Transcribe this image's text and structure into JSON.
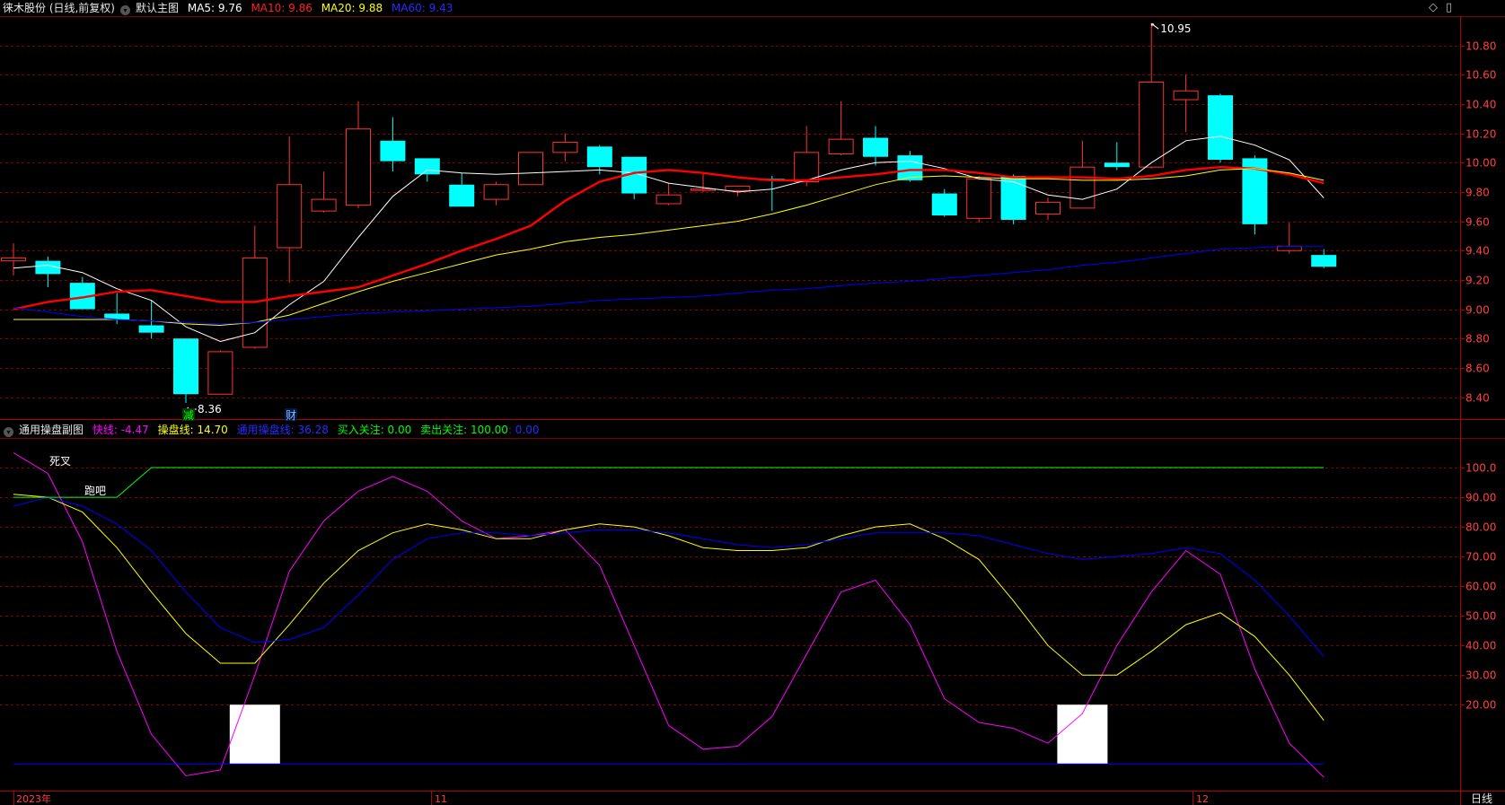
{
  "main_header": {
    "stock": "徕木股份 (日线,前复权)",
    "chart_name": "默认主图",
    "ma5": "MA5: 9.76",
    "ma10": "MA10: 9.86",
    "ma20": "MA20: 9.88",
    "ma60": "MA60: 9.43",
    "diamond_icon": "diamond-icon",
    "menu_icon": "menu-icon"
  },
  "sub_header": {
    "name": "通用操盘副图",
    "fast": "快线: -4.47",
    "op": "操盘线: 14.70",
    "general": "通用操盘线: 36.28",
    "buy": "买入关注: 0.00",
    "sell": "卖出关注: 100.00",
    "tail": ": 0.00"
  },
  "colors": {
    "bg": "#000000",
    "up": "#ff3232",
    "down": "#00ffff",
    "grid": "#800000",
    "ma5": "#ffffff",
    "ma10": "#ff0000",
    "ma20": "#ffff00",
    "ma60": "#0000ff",
    "fast": "#ff00ff",
    "op": "#ffff00",
    "general": "#0000ff",
    "sell": "#00ff00"
  },
  "annotations": {
    "high": "10.95",
    "low": "8.36",
    "jian": "减",
    "cai": "财",
    "dead_cross": "死叉",
    "run": "跑吧"
  },
  "x_labels": [
    "2023年",
    "11",
    "12"
  ],
  "period_label": "日线",
  "main_y_ticks": [
    "10.80",
    "10.60",
    "10.40",
    "10.20",
    "10.00",
    "9.80",
    "9.60",
    "9.40",
    "9.20",
    "9.00",
    "8.80",
    "8.60",
    "8.40"
  ],
  "sub_y_ticks": [
    "100.0",
    "90.00",
    "80.00",
    "70.00",
    "60.00",
    "50.00",
    "40.00",
    "30.00",
    "20.00"
  ],
  "chart_data": [
    {
      "type": "candlestick",
      "title": "默认主图",
      "ylim": [
        8.25,
        11.0
      ],
      "candles": [
        {
          "o": 9.33,
          "h": 9.45,
          "l": 9.23,
          "c": 9.35
        },
        {
          "o": 9.33,
          "h": 9.36,
          "l": 9.15,
          "c": 9.24
        },
        {
          "o": 9.18,
          "h": 9.22,
          "l": 9.0,
          "c": 9.0
        },
        {
          "o": 8.97,
          "h": 9.11,
          "l": 8.9,
          "c": 8.93
        },
        {
          "o": 8.89,
          "h": 9.06,
          "l": 8.8,
          "c": 8.84
        },
        {
          "o": 8.8,
          "h": 8.8,
          "l": 8.36,
          "c": 8.42
        },
        {
          "o": 8.42,
          "h": 8.72,
          "l": 8.42,
          "c": 8.71
        },
        {
          "o": 8.74,
          "h": 9.57,
          "l": 8.73,
          "c": 9.35
        },
        {
          "o": 9.42,
          "h": 10.18,
          "l": 9.18,
          "c": 9.85
        },
        {
          "o": 9.67,
          "h": 9.94,
          "l": 9.66,
          "c": 9.75
        },
        {
          "o": 9.71,
          "h": 10.42,
          "l": 9.69,
          "c": 10.23
        },
        {
          "o": 10.15,
          "h": 10.31,
          "l": 9.94,
          "c": 10.01
        },
        {
          "o": 10.03,
          "h": 10.03,
          "l": 9.87,
          "c": 9.92
        },
        {
          "o": 9.85,
          "h": 9.93,
          "l": 9.7,
          "c": 9.7
        },
        {
          "o": 9.75,
          "h": 9.87,
          "l": 9.71,
          "c": 9.85
        },
        {
          "o": 9.85,
          "h": 10.07,
          "l": 9.85,
          "c": 10.07
        },
        {
          "o": 10.07,
          "h": 10.2,
          "l": 10.01,
          "c": 10.14
        },
        {
          "o": 10.11,
          "h": 10.12,
          "l": 9.92,
          "c": 9.97
        },
        {
          "o": 10.04,
          "h": 10.04,
          "l": 9.75,
          "c": 9.79
        },
        {
          "o": 9.72,
          "h": 9.86,
          "l": 9.71,
          "c": 9.78
        },
        {
          "o": 9.82,
          "h": 9.93,
          "l": 9.8,
          "c": 9.82
        },
        {
          "o": 9.81,
          "h": 9.84,
          "l": 9.77,
          "c": 9.84
        },
        {
          "o": 9.89,
          "h": 9.91,
          "l": 9.67,
          "c": 9.88
        },
        {
          "o": 9.87,
          "h": 10.25,
          "l": 9.84,
          "c": 10.07
        },
        {
          "o": 10.06,
          "h": 10.42,
          "l": 10.05,
          "c": 10.16
        },
        {
          "o": 10.17,
          "h": 10.25,
          "l": 9.98,
          "c": 10.04
        },
        {
          "o": 10.05,
          "h": 10.08,
          "l": 9.87,
          "c": 9.88
        },
        {
          "o": 9.79,
          "h": 9.82,
          "l": 9.63,
          "c": 9.64
        },
        {
          "o": 9.62,
          "h": 9.91,
          "l": 9.59,
          "c": 9.89
        },
        {
          "o": 9.91,
          "h": 9.92,
          "l": 9.58,
          "c": 9.61
        },
        {
          "o": 9.65,
          "h": 9.76,
          "l": 9.61,
          "c": 9.73
        },
        {
          "o": 9.69,
          "h": 10.15,
          "l": 9.69,
          "c": 9.97
        },
        {
          "o": 10.0,
          "h": 10.14,
          "l": 9.95,
          "c": 9.97
        },
        {
          "o": 9.97,
          "h": 10.95,
          "l": 9.96,
          "c": 10.55
        },
        {
          "o": 10.43,
          "h": 10.6,
          "l": 10.21,
          "c": 10.49
        },
        {
          "o": 10.46,
          "h": 10.47,
          "l": 10.0,
          "c": 10.02
        },
        {
          "o": 10.03,
          "h": 10.05,
          "l": 9.51,
          "c": 9.58
        },
        {
          "o": 9.4,
          "h": 9.59,
          "l": 9.38,
          "c": 9.43
        },
        {
          "o": 9.37,
          "h": 9.41,
          "l": 9.28,
          "c": 9.29
        }
      ],
      "series": [
        {
          "name": "MA5",
          "values": [
            9.28,
            9.3,
            9.25,
            9.14,
            9.06,
            8.88,
            8.78,
            8.84,
            9.03,
            9.19,
            9.49,
            9.77,
            9.95,
            9.93,
            9.92,
            9.93,
            9.94,
            9.95,
            9.93,
            9.86,
            9.83,
            9.8,
            9.82,
            9.88,
            9.95,
            10.0,
            10.01,
            9.96,
            9.89,
            9.87,
            9.78,
            9.75,
            9.82,
            10.0,
            10.15,
            10.18,
            10.12,
            10.02,
            9.76
          ]
        },
        {
          "name": "MA10",
          "values": [
            9.0,
            9.05,
            9.08,
            9.12,
            9.13,
            9.09,
            9.05,
            9.05,
            9.09,
            9.12,
            9.15,
            9.23,
            9.31,
            9.4,
            9.48,
            9.57,
            9.74,
            9.87,
            9.93,
            9.95,
            9.93,
            9.9,
            9.88,
            9.88,
            9.9,
            9.92,
            9.95,
            9.95,
            9.93,
            9.9,
            9.9,
            9.9,
            9.89,
            9.91,
            9.95,
            9.97,
            9.96,
            9.92,
            9.86
          ]
        },
        {
          "name": "MA20",
          "values": [
            8.93,
            8.93,
            8.93,
            8.93,
            8.92,
            8.9,
            8.89,
            8.91,
            8.96,
            9.04,
            9.12,
            9.19,
            9.25,
            9.31,
            9.37,
            9.41,
            9.46,
            9.49,
            9.51,
            9.54,
            9.57,
            9.6,
            9.65,
            9.71,
            9.78,
            9.85,
            9.9,
            9.91,
            9.9,
            9.89,
            9.89,
            9.88,
            9.88,
            9.89,
            9.91,
            9.95,
            9.96,
            9.93,
            9.88
          ]
        },
        {
          "name": "MA60",
          "values": [
            9.01,
            8.98,
            8.95,
            8.93,
            8.92,
            8.91,
            8.9,
            8.91,
            8.93,
            8.95,
            8.97,
            8.98,
            8.99,
            9.0,
            9.01,
            9.02,
            9.04,
            9.06,
            9.07,
            9.08,
            9.09,
            9.11,
            9.13,
            9.14,
            9.16,
            9.18,
            9.19,
            9.21,
            9.23,
            9.25,
            9.27,
            9.3,
            9.32,
            9.35,
            9.38,
            9.41,
            9.42,
            9.43,
            9.43
          ]
        }
      ]
    },
    {
      "type": "line",
      "title": "通用操盘副图",
      "ylim": [
        -9,
        110
      ],
      "series": [
        {
          "name": "快线",
          "values": [
            105,
            98,
            75,
            38,
            10,
            -4,
            -2,
            30,
            65,
            82,
            92,
            97,
            92,
            82,
            76,
            77,
            79,
            67,
            40,
            13,
            5,
            6,
            16,
            37,
            58,
            62,
            47,
            22,
            14,
            12,
            7,
            17,
            40,
            58,
            72,
            64,
            32,
            7,
            -4.47
          ]
        },
        {
          "name": "操盘线",
          "values": [
            91,
            90,
            85,
            73,
            58,
            44,
            34,
            34,
            47,
            61,
            72,
            78,
            81,
            79,
            76,
            76,
            79,
            81,
            80,
            77,
            73,
            72,
            72,
            73,
            77,
            80,
            81,
            76,
            69,
            55,
            40,
            30,
            30,
            38,
            47,
            51,
            43,
            30,
            14.7
          ]
        },
        {
          "name": "通用操盘线",
          "values": [
            87,
            90,
            87,
            81,
            72,
            58,
            46,
            41,
            42,
            46,
            57,
            69,
            76,
            78,
            78,
            77,
            78,
            79,
            79,
            78,
            76,
            74,
            73,
            74,
            76,
            78,
            78,
            78,
            77,
            74,
            71,
            69,
            70,
            71,
            73,
            71,
            62,
            50,
            36.28
          ]
        },
        {
          "name": "卖出关注",
          "values": [
            90,
            90,
            90,
            90,
            100,
            100,
            100,
            100,
            100,
            100,
            100,
            100,
            100,
            100,
            100,
            100,
            100,
            100,
            100,
            100,
            100,
            100,
            100,
            100,
            100,
            100,
            100,
            100,
            100,
            100,
            100,
            100,
            100,
            100,
            100,
            100,
            100,
            100,
            100
          ]
        },
        {
          "name": "买入关注",
          "values": [
            0,
            0,
            0,
            0,
            0,
            0,
            0,
            0,
            0,
            0,
            0,
            0,
            0,
            0,
            0,
            0,
            0,
            0,
            0,
            0,
            0,
            0,
            0,
            0,
            0,
            0,
            0,
            0,
            0,
            0,
            0,
            0,
            0,
            0,
            0,
            0,
            0,
            0,
            0
          ]
        }
      ],
      "signal_bars": [
        {
          "index": 7,
          "value": 20
        },
        {
          "index": 31,
          "value": 20
        }
      ]
    }
  ]
}
